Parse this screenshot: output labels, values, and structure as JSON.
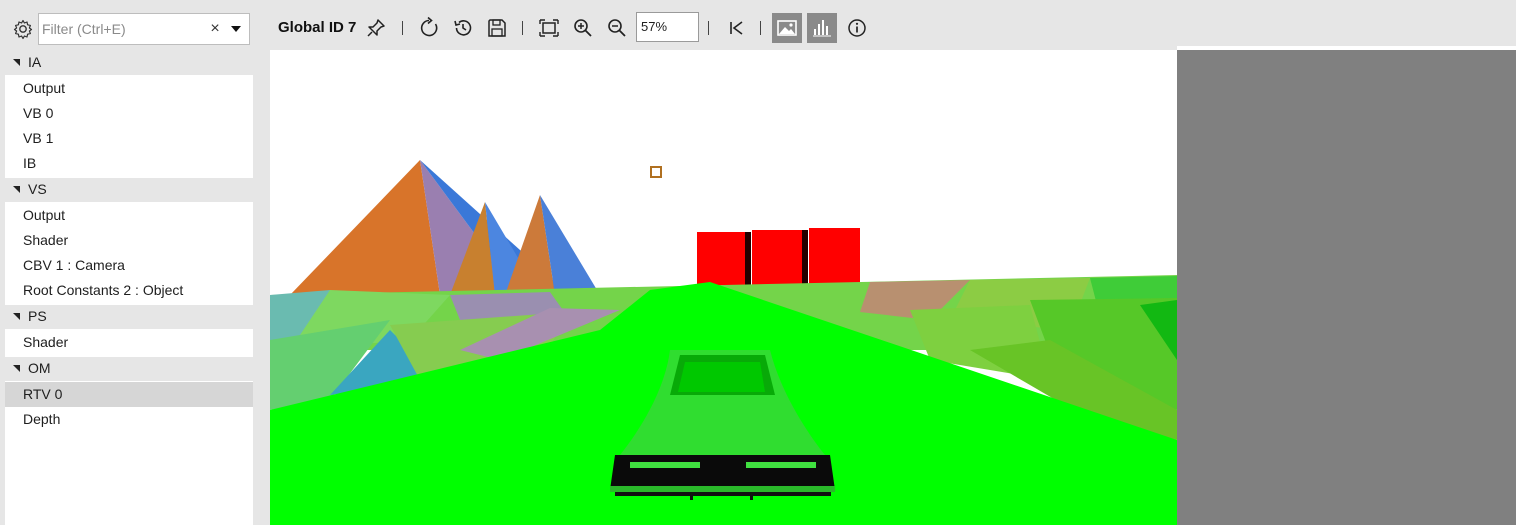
{
  "filter": {
    "placeholder": "Filter (Ctrl+E)",
    "value": "",
    "clear_glyph": "×"
  },
  "tree": [
    {
      "group": "IA",
      "items": [
        "Output",
        "VB 0",
        "VB 1",
        "IB"
      ]
    },
    {
      "group": "VS",
      "items": [
        "Output",
        "Shader",
        "CBV 1 : Camera",
        "Root Constants 2 : Object"
      ]
    },
    {
      "group": "PS",
      "items": [
        "Shader"
      ]
    },
    {
      "group": "OM",
      "items": [
        "RTV 0",
        "Depth"
      ]
    }
  ],
  "selected_item": "RTV 0",
  "toolbar": {
    "title": "Global ID 7",
    "zoom": "57%",
    "icons": [
      "pin-icon",
      "refresh-icon",
      "history-icon",
      "save-icon",
      "fit-icon",
      "zoom-in-icon",
      "zoom-out-icon",
      "first-frame-icon",
      "image-view-icon",
      "histogram-icon",
      "info-icon"
    ],
    "active_toggles": [
      "image-view-icon",
      "histogram-icon"
    ]
  },
  "colors": {
    "panel": "#e6e6e6",
    "selection": "#d6d6d6",
    "render_bg": "#ffffff",
    "outside_area": "#808080",
    "ground_green": "#00ff00",
    "toggle_active": "#8a8a8a"
  }
}
